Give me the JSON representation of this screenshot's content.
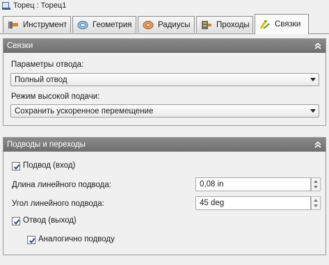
{
  "window": {
    "title": "Торец : Торец1",
    "icon": "document-icon"
  },
  "tabs": [
    {
      "label": "Инструмент",
      "icon": "tool-icon",
      "active": false
    },
    {
      "label": "Геометрия",
      "icon": "geometry-icon",
      "active": false
    },
    {
      "label": "Радиусы",
      "icon": "radii-icon",
      "active": false
    },
    {
      "label": "Проходы",
      "icon": "passes-icon",
      "active": false
    },
    {
      "label": "Связки",
      "icon": "linking-icon",
      "active": true
    }
  ],
  "links_section": {
    "title": "Связки",
    "retract_params_label": "Параметры отвода:",
    "retract_params_value": "Полный отвод",
    "high_feed_label": "Режим высокой подачи:",
    "high_feed_value": "Сохранить ускоренное перемещение"
  },
  "leads_section": {
    "title": "Подводы и переходы",
    "lead_in": {
      "label": "Подвод (вход)",
      "checked": true
    },
    "linear_lead_length": {
      "label": "Длина линейного подвода:",
      "value": "0,08 in"
    },
    "linear_lead_angle": {
      "label": "Угол линейного подвода:",
      "value": "45 deg"
    },
    "lead_out": {
      "label": "Отвод (выход)",
      "checked": true
    },
    "same_as_lead_in": {
      "label": "Аналогично подводу",
      "checked": true
    }
  },
  "colors": {
    "header_bg": "#7c7c7c",
    "header_text": "#ffffff",
    "window_bg": "#f0f0f0"
  }
}
